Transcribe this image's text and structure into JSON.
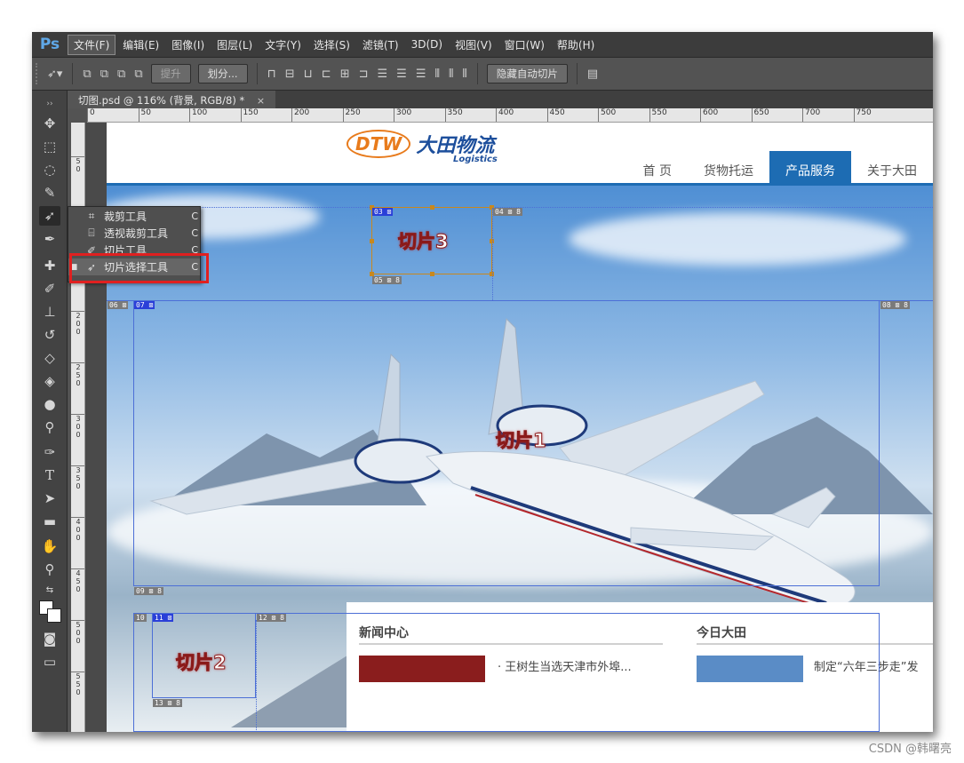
{
  "app": {
    "logo": "Ps"
  },
  "menu": [
    "文件(F)",
    "编辑(E)",
    "图像(I)",
    "图层(L)",
    "文字(Y)",
    "选择(S)",
    "滤镜(T)",
    "3D(D)",
    "视图(V)",
    "窗口(W)",
    "帮助(H)"
  ],
  "options": {
    "promote": "提升",
    "divide": "划分...",
    "hide_auto": "隐藏自动切片"
  },
  "document_tab": {
    "title": "切图.psd @ 116% (背景, RGB/8) *",
    "close": "×"
  },
  "ruler_top": [
    "0",
    "50",
    "100",
    "150",
    "200",
    "250",
    "300",
    "350",
    "400",
    "450",
    "500",
    "550",
    "600",
    "650",
    "700",
    "750"
  ],
  "ruler_left": [
    "50",
    "100",
    "150",
    "200",
    "250",
    "300",
    "350",
    "400",
    "450",
    "500",
    "550"
  ],
  "flyout": [
    {
      "label": "裁剪工具",
      "key": "C",
      "icon": "crop-icon",
      "active": false
    },
    {
      "label": "透视裁剪工具",
      "key": "C",
      "icon": "perspective-crop-icon",
      "active": false
    },
    {
      "label": "切片工具",
      "key": "C",
      "icon": "slice-icon",
      "active": false
    },
    {
      "label": "切片选择工具",
      "key": "C",
      "icon": "slice-select-icon",
      "active": true
    }
  ],
  "site": {
    "logo_mark": "DTW",
    "logo_name": "大田物流",
    "logo_sub": "Logistics",
    "nav": [
      "首 页",
      "货物托运",
      "产品服务",
      "关于大田"
    ],
    "nav_active": 2
  },
  "slices": {
    "s01": "切片1",
    "s02": "切片2",
    "s03": "切片3",
    "labels": [
      "03",
      "04",
      "05",
      "06",
      "07",
      "08",
      "09",
      "10",
      "11",
      "12",
      "13"
    ],
    "icon": "⊠ 8"
  },
  "news": {
    "left_title": "新闻中心",
    "left_item": "· 王树生当选天津市外埠...",
    "right_title": "今日大田",
    "right_item": "制定“六年三步走”发"
  },
  "watermark": "CSDN @韩曙亮",
  "colors": {
    "slice_border": "#4c6fd6",
    "selected_slice": "#c8881e",
    "nav_active": "#1d6cb3",
    "highlight": "#e02020"
  }
}
